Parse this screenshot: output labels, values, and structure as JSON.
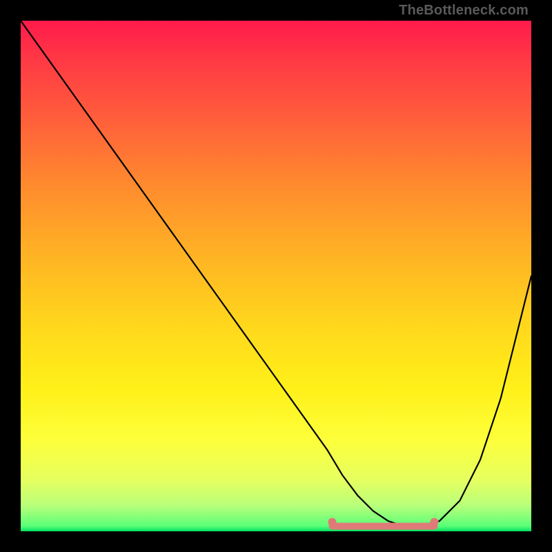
{
  "watermark": "TheBottleneck.com",
  "chart_data": {
    "type": "line",
    "title": "",
    "xlabel": "",
    "ylabel": "",
    "xlim": [
      0,
      100
    ],
    "ylim": [
      0,
      100
    ],
    "grid": false,
    "legend": false,
    "series": [
      {
        "name": "bottleneck-curve",
        "color": "#000000",
        "x": [
          0,
          5,
          10,
          15,
          20,
          25,
          30,
          35,
          40,
          45,
          50,
          55,
          60,
          63,
          66,
          69,
          72,
          75,
          78,
          82,
          86,
          90,
          94,
          97,
          100
        ],
        "values": [
          100,
          93,
          86,
          79,
          72,
          65,
          58,
          51,
          44,
          37,
          30,
          23,
          16,
          11,
          7,
          4,
          2,
          1,
          1,
          2,
          6,
          14,
          26,
          38,
          50
        ]
      }
    ],
    "highlight_range": {
      "name": "optimal-range",
      "color": "#e07a78",
      "x_start": 61,
      "x_end": 81,
      "y": 1
    }
  }
}
